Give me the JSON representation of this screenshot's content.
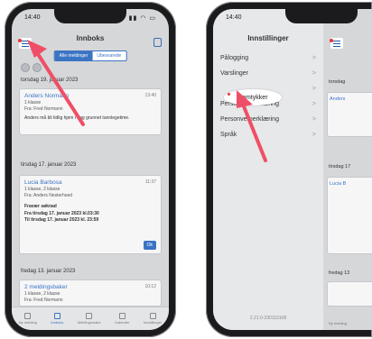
{
  "left": {
    "time": "14:40",
    "status_icons": "▮▮ ◠ ▭",
    "title": "Innboks",
    "tabs": [
      "Alle meldinger",
      "Ubesvarede"
    ],
    "sections": [
      {
        "date": "torsdag 19. januar 2023",
        "name": "Anders Normann",
        "line1": "1 klasse",
        "line2": "Fra: Fred Normann",
        "time": "13:40",
        "body": "Anders må bli tidlig hjem i dag grunnet tannlegetime."
      },
      {
        "date": "tirsdag 17. januar 2023",
        "name": "Lucia Barbosa",
        "line1": "1 klasse, 2 klasse",
        "line2": "Fra: Anders Nesterhoed",
        "time": "11:37",
        "body_title": "Fravær søknad",
        "body_l1": "Fra tirsdag 17. januar 2023 kl.03:30",
        "body_l2": "Til tirsdag 17. januar 2023 kl. 23:59",
        "ok": "Ok"
      },
      {
        "date": "fredag 13. januar 2023",
        "name": "2 meldingsbaker",
        "line1": "1 klasse, 2 klasse",
        "line2": "Fra: Fred Normann",
        "time": "10:12"
      }
    ],
    "tabbar": [
      {
        "label": "Ny melding",
        "active": false
      },
      {
        "label": "Innboks",
        "active": true
      },
      {
        "label": "Meldingsmaler",
        "active": false
      },
      {
        "label": "Kalender",
        "active": false
      },
      {
        "label": "Innstillinger",
        "active": false
      }
    ]
  },
  "right": {
    "time": "14:40",
    "status_icons": "▮▮ ◠",
    "title": "Innstillinger",
    "menu": [
      {
        "label": "Pålogging",
        "chevron": ">"
      },
      {
        "label": "Varslinger",
        "chevron": ">"
      },
      {
        "label": "",
        "chevron": ">"
      },
      {
        "label": "Personvernerklæring",
        "chevron": ">"
      },
      {
        "label": "Personvernerklæring",
        "chevron": ">"
      },
      {
        "label": "Språk",
        "chevron": ">"
      }
    ],
    "highlight_label": "Samtykker",
    "version": "2.21.0-230110108",
    "peek": {
      "date1": "torsdag",
      "name1": "Anders",
      "date2": "tirsdag 17",
      "name2": "Lucia B",
      "date3": "fredag 13",
      "tab": "Ny melding"
    }
  },
  "colors": {
    "accent": "#3b74c4",
    "arrow": "#ef4f66",
    "dot": "#e8323c"
  }
}
